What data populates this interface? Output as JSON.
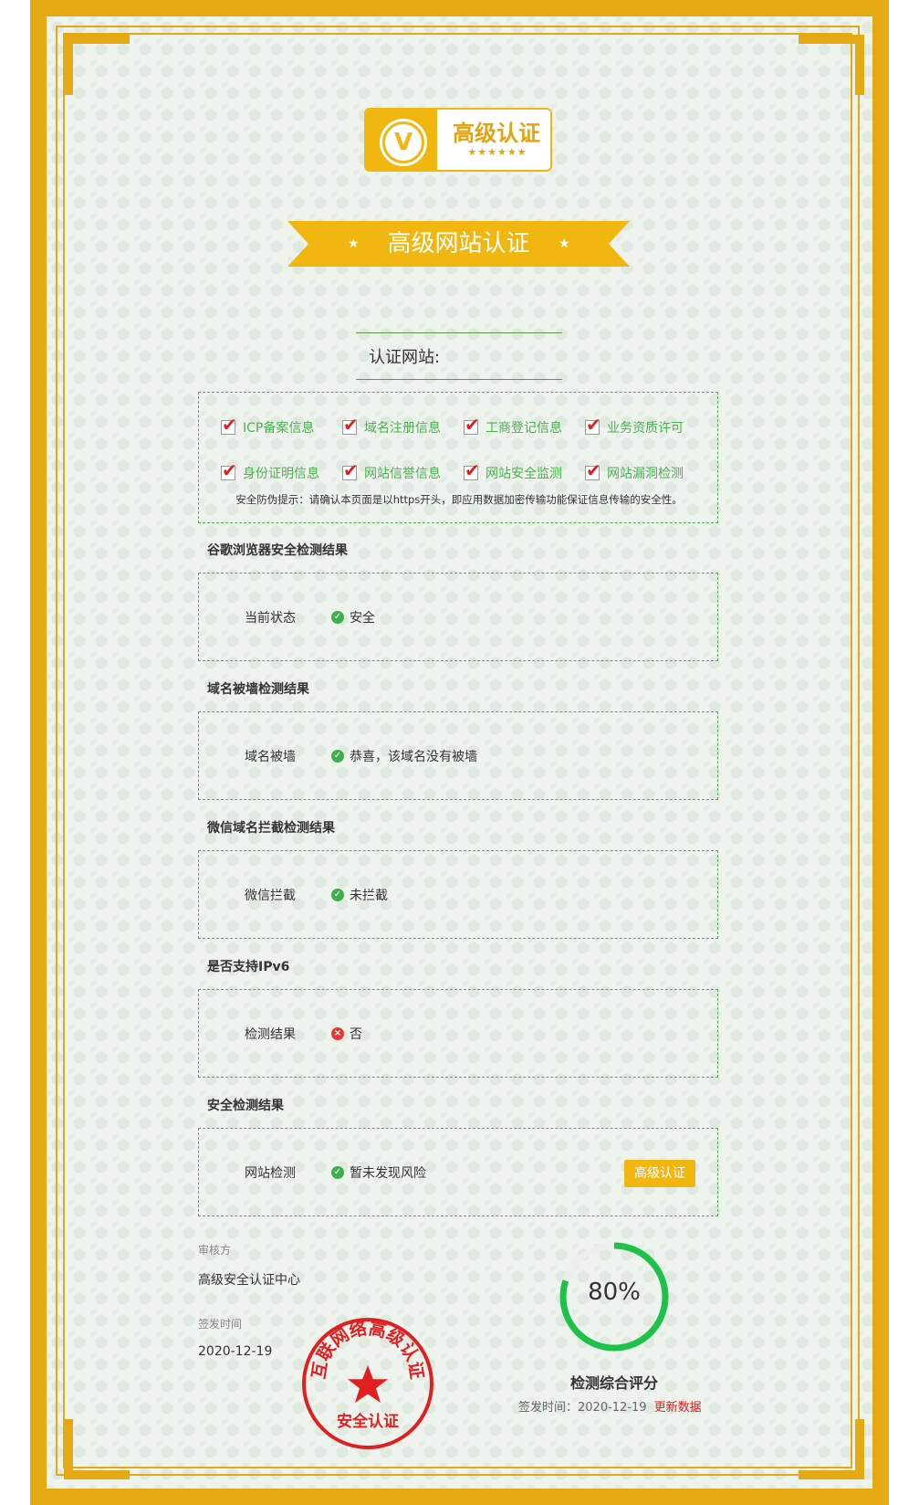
{
  "badge": {
    "title": "高级认证",
    "stars": "★★★★★★",
    "logo_letter": "V"
  },
  "ribbon": {
    "title": "高级网站认证",
    "star": "★"
  },
  "site": {
    "label": "认证网站:"
  },
  "checks": {
    "items": [
      "ICP备案信息",
      "域名注册信息",
      "工商登记信息",
      "业务资质许可",
      "身份证明信息",
      "网站信誉信息",
      "网站安全监测",
      "网站漏洞检测"
    ],
    "check_mark": "✔",
    "tip": "安全防伪提示：请确认本页面是以https开头，即应用数据加密传输功能保证信息传输的安全性。"
  },
  "sections": [
    {
      "title": "谷歌浏览器安全检测结果",
      "key": "当前状态",
      "value": "安全",
      "status": "ok"
    },
    {
      "title": "域名被墙检测结果",
      "key": "域名被墙",
      "value": "恭喜，该域名没有被墙",
      "status": "ok"
    },
    {
      "title": "微信域名拦截检测结果",
      "key": "微信拦截",
      "value": "未拦截",
      "status": "ok"
    },
    {
      "title": "是否支持IPv6",
      "key": "检测结果",
      "value": "否",
      "status": "bad"
    },
    {
      "title": "安全检测结果",
      "key": "网站检测",
      "value": "暂未发现风险",
      "status": "ok",
      "button": "高级认证"
    }
  ],
  "icons": {
    "ok": "✓",
    "bad": "×"
  },
  "meta": {
    "reviewer_label": "审核方",
    "reviewer": "高级安全认证中心",
    "issue_label": "签发时间",
    "issue_date": "2020-12-19"
  },
  "seal": {
    "top_text": "互联网络高级认证",
    "bottom_text": "安全认证",
    "color": "#e02020"
  },
  "score": {
    "percent_value": 80,
    "percent_text": "80%",
    "title": "检测综合评分",
    "sign_label": "签发时间：",
    "sign_date": "2020-12-19",
    "update_link": "更新数据"
  },
  "colors": {
    "gold": "#e5aa13",
    "green": "#4caf50",
    "gauge": "#1ec24a",
    "red": "#e02020"
  }
}
